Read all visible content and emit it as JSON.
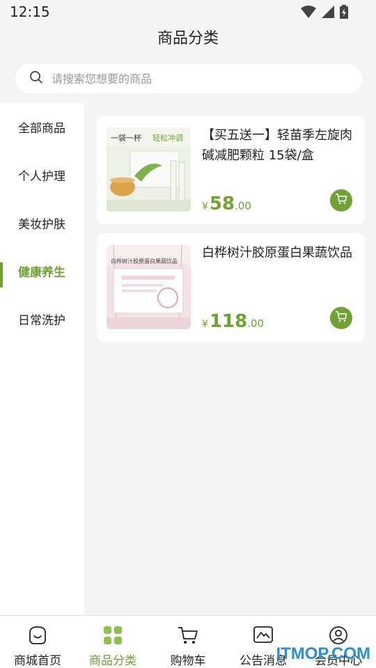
{
  "status_bar": {
    "time": "12:15"
  },
  "header": {
    "title": "商品分类"
  },
  "search": {
    "placeholder": "请搜索您想要的商品"
  },
  "sidebar": {
    "items": [
      {
        "label": "全部商品",
        "active": false
      },
      {
        "label": "个人护理",
        "active": false
      },
      {
        "label": "美妆护肤",
        "active": false
      },
      {
        "label": "健康养生",
        "active": true
      },
      {
        "label": "日常洗护",
        "active": false
      }
    ]
  },
  "products": [
    {
      "name": "【买五送一】轻苗季左旋肉碱减肥颗粒 15袋/盒",
      "currency": "¥",
      "price_int": "58",
      "price_dec": ".00",
      "image_text_1": "一袋一杯",
      "image_text_2": "轻松冲调"
    },
    {
      "name": "白桦树汁胶原蛋白果蔬饮品",
      "currency": "¥",
      "price_int": "118",
      "price_dec": ".00",
      "image_text_1": "白桦树汁胶原蛋白果蔬饮品"
    }
  ],
  "tab_bar": {
    "tabs": [
      {
        "label": "商城首页",
        "icon": "home-icon",
        "active": false
      },
      {
        "label": "商品分类",
        "icon": "category-grid-icon",
        "active": true
      },
      {
        "label": "购物车",
        "icon": "cart-icon",
        "active": false
      },
      {
        "label": "公告消息",
        "icon": "notice-icon",
        "active": false
      },
      {
        "label": "会员中心",
        "icon": "user-icon",
        "active": false
      }
    ]
  },
  "watermark": {
    "text": "ITMOP.COM"
  },
  "colors": {
    "accent": "#6fa133",
    "background": "#f4f4f4",
    "card": "#ffffff"
  }
}
